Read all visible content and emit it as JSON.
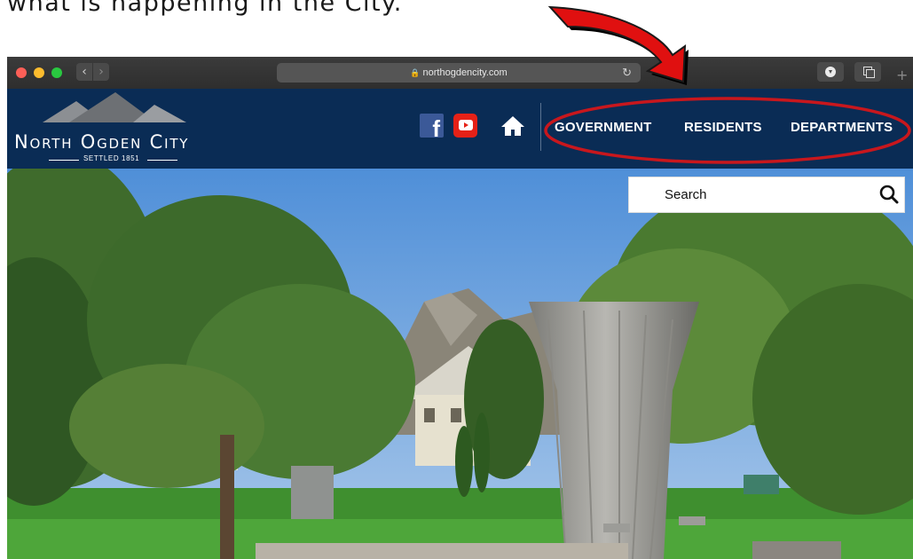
{
  "caption": "what is happening in the City.",
  "browser": {
    "url": "northogdencity.com",
    "icons": [
      "close-dot",
      "minimize-dot",
      "zoom-dot",
      "back-icon",
      "forward-icon",
      "lock-icon",
      "reload-icon",
      "download-icon",
      "tabs-icon",
      "plus-icon"
    ]
  },
  "site": {
    "logo": {
      "name": "North Ogden City",
      "tagline": "SETTLED 1851"
    },
    "social": [
      "facebook-icon",
      "youtube-icon"
    ],
    "nav": {
      "home_icon": "home-icon",
      "items": [
        "GOVERNMENT",
        "RESIDENTS",
        "DEPARTMENTS"
      ]
    },
    "search": {
      "placeholder": "Search"
    }
  },
  "annotation": {
    "arrow_color": "#e01010",
    "ellipse_color": "#c8171d"
  },
  "colors": {
    "header_bg": "#0a2c55",
    "titlebar_bg": "#2e2e2e"
  }
}
